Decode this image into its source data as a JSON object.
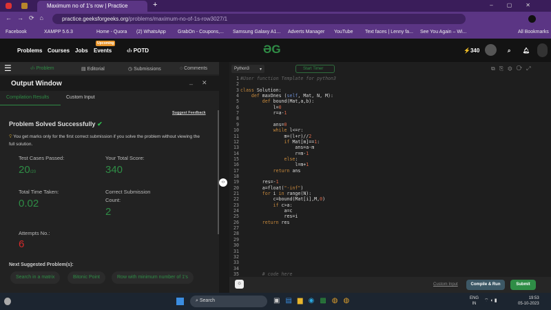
{
  "browser": {
    "tab_title": "Maximum no of 1's row | Practice",
    "url_host": "practice.geeksforgeeks.org",
    "url_path": "/problems/maximum-no-of-1s-row3027/1",
    "bookmarks": [
      "Facebook",
      "XAMPP 5.6.3",
      "Home - Quora",
      "(2) WhatsApp",
      "GrabOn - Coupons,...",
      "Samsung Galaxy A1...",
      "Adverts Manager",
      "YouTube",
      "Text faces | Lenny fa...",
      "See You Again – Wi...",
      "All Bookmarks"
    ]
  },
  "nav": {
    "items": [
      "Problems",
      "Courses",
      "Jobs",
      "Events"
    ],
    "events_badge": "Upcoming",
    "potd": "POTD",
    "logo": "GfG",
    "streak": "340"
  },
  "panel_tabs": [
    "Problem",
    "Editorial",
    "Submissions",
    "Comments"
  ],
  "output": {
    "title": "Output Window",
    "tabs": [
      "Compilation Results",
      "Custom Input"
    ],
    "suggest_feedback": "Suggest Feedback",
    "status": "Problem Solved Successfully",
    "note": "You get marks only for the first correct submission if you solve the problem without viewing the full solution.",
    "test_cases_label": "Test Cases Passed:",
    "test_cases_value": "20",
    "test_cases_total": "/20",
    "score_label": "Your Total Score:",
    "score_value": "340",
    "time_label": "Total Time Taken:",
    "time_value": "0.02",
    "correct_label_1": "Correct Submission",
    "correct_label_2": "Count:",
    "correct_value": "2",
    "attempts_label": "Attempts No.:",
    "attempts_value": "6",
    "next_label": "Next Suggested Problem(s):",
    "suggestions": [
      "Search in a matrix",
      "Bitonic Point",
      "Row with minimum number of 1's"
    ]
  },
  "editor": {
    "language": "Python3",
    "start_timer": "Start Timer",
    "lines": [
      [
        [
          "#User function Template for python3",
          "cm"
        ]
      ],
      [],
      [
        [
          "class ",
          "kw"
        ],
        [
          "Solution:",
          ""
        ]
      ],
      [
        [
          "    def ",
          "kw"
        ],
        [
          "maxOnes (",
          ""
        ],
        [
          "self",
          "sf"
        ],
        [
          ", Mat, N, M):",
          ""
        ]
      ],
      [
        [
          "        def ",
          "kw"
        ],
        [
          "bound(Mat,a,b):",
          ""
        ]
      ],
      [
        [
          "            l=",
          ""
        ],
        [
          "0",
          "num"
        ]
      ],
      [
        [
          "            r=a-",
          ""
        ],
        [
          "1",
          "num"
        ]
      ],
      [],
      [
        [
          "            ans=",
          ""
        ],
        [
          "0",
          "num"
        ]
      ],
      [
        [
          "            while ",
          "kw"
        ],
        [
          "l<=r:",
          ""
        ]
      ],
      [
        [
          "                m=(l+r)//",
          ""
        ],
        [
          "2",
          "num"
        ]
      ],
      [
        [
          "                if ",
          "kw"
        ],
        [
          "Mat[m]==",
          ""
        ],
        [
          "1",
          "num"
        ],
        [
          ":",
          ""
        ]
      ],
      [
        [
          "                    ans=a-m",
          ""
        ]
      ],
      [
        [
          "                    r=m-",
          ""
        ],
        [
          "1",
          "num"
        ]
      ],
      [
        [
          "                else",
          "kw"
        ],
        [
          ":",
          ""
        ]
      ],
      [
        [
          "                    l=m+",
          ""
        ],
        [
          "1",
          "num"
        ]
      ],
      [
        [
          "            return ",
          "kw"
        ],
        [
          "ans",
          ""
        ]
      ],
      [],
      [
        [
          "        res=-",
          ""
        ],
        [
          "1",
          "num"
        ]
      ],
      [
        [
          "        a=float(",
          ""
        ],
        [
          "\"-inf\"",
          "str"
        ],
        [
          ")",
          ""
        ]
      ],
      [
        [
          "        for ",
          "kw"
        ],
        [
          "i ",
          ""
        ],
        [
          "in ",
          "kw"
        ],
        [
          "range(N):",
          ""
        ]
      ],
      [
        [
          "            c=bound(Mat[i],M,",
          ""
        ],
        [
          "0",
          "num"
        ],
        [
          ")",
          ""
        ]
      ],
      [
        [
          "            if ",
          "kw"
        ],
        [
          "c>a:",
          ""
        ]
      ],
      [
        [
          "                a=c",
          ""
        ]
      ],
      [
        [
          "                res=i",
          ""
        ]
      ],
      [
        [
          "        return ",
          "kw"
        ],
        [
          "res",
          ""
        ]
      ],
      [],
      [],
      [],
      [],
      [],
      [],
      [],
      [],
      [
        [
          "        # code here",
          "cm"
        ]
      ]
    ],
    "custom_input": "Custom Input",
    "compile_run": "Compile & Run",
    "submit": "Submit"
  },
  "taskbar": {
    "search": "Search",
    "lang": "ENG",
    "region": "IN",
    "time": "19:53",
    "date": "05-10-2023"
  }
}
